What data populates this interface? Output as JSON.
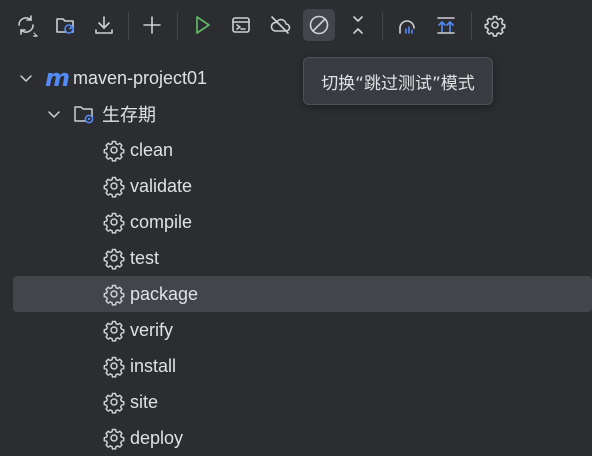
{
  "toolbar": {
    "buttons": [
      {
        "name": "reload-all-projects",
        "icon": "reload-icon"
      },
      {
        "name": "generate-sources",
        "icon": "folder-refresh-icon"
      },
      {
        "name": "download-sources",
        "icon": "download-icon"
      },
      {
        "name": "add-maven-project",
        "icon": "plus-icon"
      },
      {
        "name": "run-maven-build",
        "icon": "run-icon"
      },
      {
        "name": "execute-maven-goal",
        "icon": "terminal-icon"
      },
      {
        "name": "toggle-offline-mode",
        "icon": "offline-cloud-icon"
      },
      {
        "name": "toggle-skip-tests",
        "icon": "skip-icon"
      },
      {
        "name": "collapse-all",
        "icon": "collapse-icon"
      },
      {
        "name": "analyze-dependencies",
        "icon": "analyze-icon"
      },
      {
        "name": "show-dependencies",
        "icon": "dependencies-icon"
      },
      {
        "name": "maven-settings",
        "icon": "gear-icon"
      }
    ],
    "accent_color": "#548af7",
    "run_color": "#5fb865"
  },
  "tooltip": {
    "text": "切换“跳过测试”模式"
  },
  "tree": {
    "project": {
      "label": "maven-project01",
      "logo": "m"
    },
    "lifecycle": {
      "label": "生存期"
    },
    "goals": [
      {
        "label": "clean"
      },
      {
        "label": "validate"
      },
      {
        "label": "compile"
      },
      {
        "label": "test"
      },
      {
        "label": "package",
        "selected": true
      },
      {
        "label": "verify"
      },
      {
        "label": "install"
      },
      {
        "label": "site"
      },
      {
        "label": "deploy"
      }
    ]
  }
}
